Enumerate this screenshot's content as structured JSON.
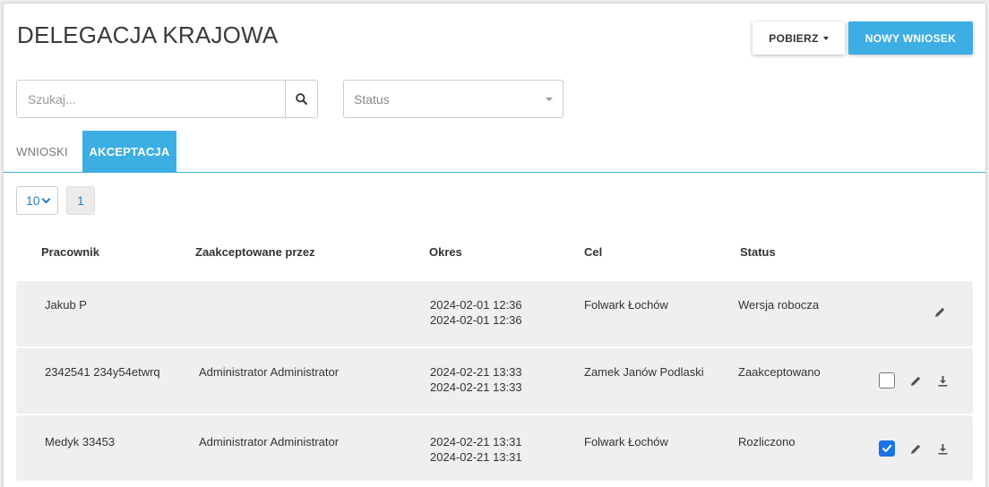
{
  "header": {
    "title": "DELEGACJA KRAJOWA",
    "pobierz_label": "POBIERZ",
    "nowy_label": "NOWY WNIOSEK"
  },
  "filters": {
    "search_placeholder": "Szukaj...",
    "status_placeholder": "Status"
  },
  "tabs": [
    {
      "label": "WNIOSKI",
      "active": false
    },
    {
      "label": "AKCEPTACJA",
      "active": true
    }
  ],
  "pagination": {
    "page_size": "10",
    "current_page": "1"
  },
  "table": {
    "columns": [
      "Pracownik",
      "Zaakceptowane przez",
      "Okres",
      "Cel",
      "Status"
    ],
    "rows": [
      {
        "pracownik": "Jakub P",
        "zaakceptowane": "",
        "okres_od": "2024-02-01 12:36",
        "okres_do": "2024-02-01 12:36",
        "cel": "Folwark Łochów",
        "status": "Wersja robocza",
        "has_checkbox": false,
        "checked": false,
        "has_download": false
      },
      {
        "pracownik": "2342541 234y54etwrq",
        "zaakceptowane": "Administrator Administrator",
        "okres_od": "2024-02-21 13:33",
        "okres_do": "2024-02-21 13:33",
        "cel": "Zamek Janów Podlaski",
        "status": "Zaakceptowano",
        "has_checkbox": true,
        "checked": false,
        "has_download": true
      },
      {
        "pracownik": "Medyk 33453",
        "zaakceptowane": "Administrator Administrator",
        "okres_od": "2024-02-21 13:31",
        "okres_do": "2024-02-21 13:31",
        "cel": "Folwark Łochów",
        "status": "Rozliczono",
        "has_checkbox": true,
        "checked": true,
        "has_download": true
      }
    ]
  },
  "colors": {
    "accent": "#3daee3",
    "checkbox_checked": "#1a73e8"
  }
}
